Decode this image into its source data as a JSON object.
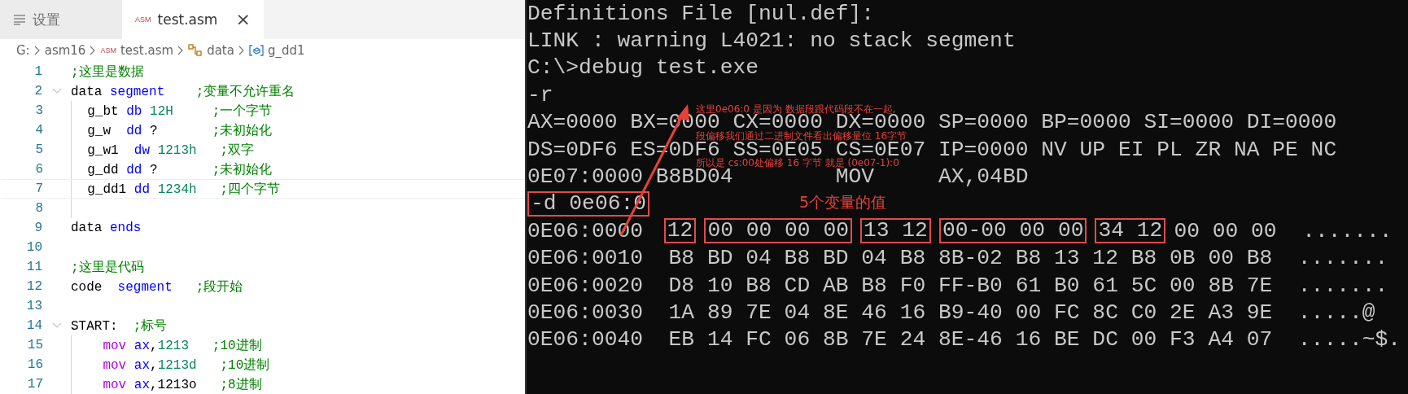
{
  "editor": {
    "tabs": [
      {
        "label": "设置",
        "kind": "settings",
        "selected": false
      },
      {
        "label": "test.asm",
        "kind": "asm",
        "icon_text": "ASM",
        "close": "×",
        "selected": true
      }
    ],
    "breadcrumb": [
      {
        "label": "G:",
        "kind": "drive"
      },
      {
        "label": "asm16",
        "kind": "folder"
      },
      {
        "label": "test.asm",
        "kind": "file",
        "icon_text": "ASM"
      },
      {
        "label": "data",
        "kind": "namespace"
      },
      {
        "label": "g_dd1",
        "kind": "variable"
      }
    ],
    "lines": [
      {
        "number": "1",
        "fold": false,
        "current": false,
        "tokens": [
          {
            "text": ";这里是数据",
            "kind": "comment"
          }
        ]
      },
      {
        "number": "2",
        "fold": true,
        "current": false,
        "tokens": [
          {
            "text": "data ",
            "kind": "plain"
          },
          {
            "text": "segment",
            "kind": "keyword"
          },
          {
            "text": "    ;变量不允许重名",
            "kind": "comment"
          }
        ],
        "children": [
          {
            "number": "3",
            "fold": false,
            "current": false,
            "tokens": [
              {
                "text": "  g_bt ",
                "kind": "plain"
              },
              {
                "text": "db ",
                "kind": "keyword"
              },
              {
                "text": "12H",
                "kind": "number"
              },
              {
                "text": "     ;一个字节",
                "kind": "comment"
              }
            ]
          },
          {
            "number": "4",
            "fold": false,
            "current": false,
            "tokens": [
              {
                "text": "  g_w  ",
                "kind": "plain"
              },
              {
                "text": "dd ",
                "kind": "keyword"
              },
              {
                "text": "?",
                "kind": "plain"
              },
              {
                "text": "       ;未初始化",
                "kind": "comment"
              }
            ]
          },
          {
            "number": "5",
            "fold": false,
            "current": false,
            "tokens": [
              {
                "text": "  g_w1  ",
                "kind": "plain"
              },
              {
                "text": "dw ",
                "kind": "keyword"
              },
              {
                "text": "1213h",
                "kind": "number"
              },
              {
                "text": "   ;双字",
                "kind": "comment"
              }
            ]
          },
          {
            "number": "6",
            "fold": false,
            "current": false,
            "tokens": [
              {
                "text": "  g_dd ",
                "kind": "plain"
              },
              {
                "text": "dd ",
                "kind": "keyword"
              },
              {
                "text": "?",
                "kind": "plain"
              },
              {
                "text": "       ;未初始化",
                "kind": "comment"
              }
            ]
          },
          {
            "number": "7",
            "fold": false,
            "current": true,
            "tokens": [
              {
                "text": "  g_dd1 ",
                "kind": "plain"
              },
              {
                "text": "dd ",
                "kind": "keyword"
              },
              {
                "text": "1234h",
                "kind": "number"
              },
              {
                "text": "   ;四个字节",
                "kind": "comment"
              }
            ]
          },
          {
            "number": "8",
            "fold": false,
            "current": false
          }
        ]
      },
      {
        "number": "9",
        "fold": false,
        "current": false,
        "tokens": [
          {
            "text": "data ",
            "kind": "plain"
          },
          {
            "text": "ends",
            "kind": "keyword"
          }
        ]
      },
      {
        "number": "10",
        "fold": false,
        "current": false
      },
      {
        "number": "11",
        "fold": false,
        "current": false,
        "tokens": [
          {
            "text": ";这里是代码",
            "kind": "comment"
          }
        ]
      },
      {
        "number": "12",
        "fold": false,
        "current": false,
        "tokens": [
          {
            "text": "code  ",
            "kind": "plain"
          },
          {
            "text": "segment",
            "kind": "keyword"
          },
          {
            "text": "   ;段开始",
            "kind": "comment"
          }
        ]
      },
      {
        "number": "13",
        "fold": false,
        "current": false
      },
      {
        "number": "14",
        "fold": true,
        "current": false,
        "tokens": [
          {
            "text": "START:  ",
            "kind": "plain"
          },
          {
            "text": ";标号",
            "kind": "comment"
          }
        ],
        "children": [
          {
            "number": "15",
            "fold": false,
            "current": false,
            "tokens": [
              {
                "text": "    mov ",
                "kind": "instr"
              },
              {
                "text": "ax",
                "kind": "register"
              },
              {
                "text": ",",
                "kind": "plain"
              },
              {
                "text": "1213",
                "kind": "number"
              },
              {
                "text": "   ;10进制",
                "kind": "comment"
              }
            ]
          },
          {
            "number": "16",
            "fold": false,
            "current": false,
            "tokens": [
              {
                "text": "    mov ",
                "kind": "instr"
              },
              {
                "text": "ax",
                "kind": "register"
              },
              {
                "text": ",",
                "kind": "plain"
              },
              {
                "text": "1213d",
                "kind": "number"
              },
              {
                "text": "   ;10进制",
                "kind": "comment"
              }
            ]
          },
          {
            "number": "17",
            "fold": false,
            "current": false,
            "tokens": [
              {
                "text": "    mov ",
                "kind": "instr"
              },
              {
                "text": "ax",
                "kind": "register"
              },
              {
                "text": ",1213o",
                "kind": "plain"
              },
              {
                "text": "   ;8进制",
                "kind": "comment"
              }
            ]
          }
        ]
      }
    ]
  },
  "terminal": {
    "lines": [
      {
        "segments": [
          {
            "text": "Definitions File [nul.def]:",
            "boxed": false
          }
        ]
      },
      {
        "segments": [
          {
            "text": "LINK : warning L4021: no stack segment",
            "boxed": false
          }
        ]
      },
      {
        "segments": [
          {
            "text": "C:\\>debug test.exe",
            "boxed": false
          }
        ]
      },
      {
        "segments": [
          {
            "text": "-r",
            "boxed": false
          }
        ]
      },
      {
        "segments": [
          {
            "text": "AX=0000 BX=0000 CX=0000 DX=0000 SP=0000 BP=0000 SI=0000 DI=0000",
            "boxed": false
          }
        ]
      },
      {
        "segments": [
          {
            "text": "DS=0DF6 ES=0DF6 SS=0E05 CS=0E07 IP=0000 NV UP EI PL ZR NA PE NC",
            "boxed": false
          }
        ]
      },
      {
        "segments": [
          {
            "text": "0E07:0000 B8BD04        MOV     AX,04BD",
            "boxed": false
          }
        ]
      },
      {
        "segments": [
          {
            "text": "-d 0e06:0",
            "boxed": true
          }
        ]
      },
      {
        "segments": [
          {
            "text": "0E06:0000 ",
            "boxed": false
          },
          {
            "text": "12",
            "boxed": true
          },
          {
            "text": "00 00 00 00",
            "boxed": true
          },
          {
            "text": "13 12",
            "boxed": true
          },
          {
            "text": "00-00 00 00",
            "boxed": true
          },
          {
            "text": "34 12",
            "boxed": true
          },
          {
            "text": "00 00 00  .......",
            "boxed": false
          }
        ]
      },
      {
        "segments": [
          {
            "text": "0E06:0010  B8 BD 04 B8 BD 04 B8 8B-02 B8 13 12 B8 0B 00 B8  .......",
            "boxed": false
          }
        ]
      },
      {
        "segments": [
          {
            "text": "0E06:0020  D8 10 B8 CD AB B8 F0 FF-B0 61 B0 61 5C 00 8B 7E  .......",
            "boxed": false
          }
        ]
      },
      {
        "segments": [
          {
            "text": "0E06:0030  1A 89 7E 04 8E 46 16 B9-40 00 FC 8C C0 2E A3 9E  .....@",
            "boxed": false
          }
        ]
      },
      {
        "segments": [
          {
            "text": "0E06:0040  EB 14 FC 06 8B 7E 24 8E-46 16 BE DC 00 F3 A4 07  .....~$.",
            "boxed": false
          }
        ]
      }
    ],
    "annotations": {
      "note_lines": [
        "这里0e06:0  是因为 数据段跟代码段不在一起,",
        "段偏移我们通过二进制文件看出偏移量位 16字节",
        "所以是 cs:00处偏移 16 字节  就是 (0e07-1):0"
      ],
      "box_label": "5个变量的值"
    }
  }
}
